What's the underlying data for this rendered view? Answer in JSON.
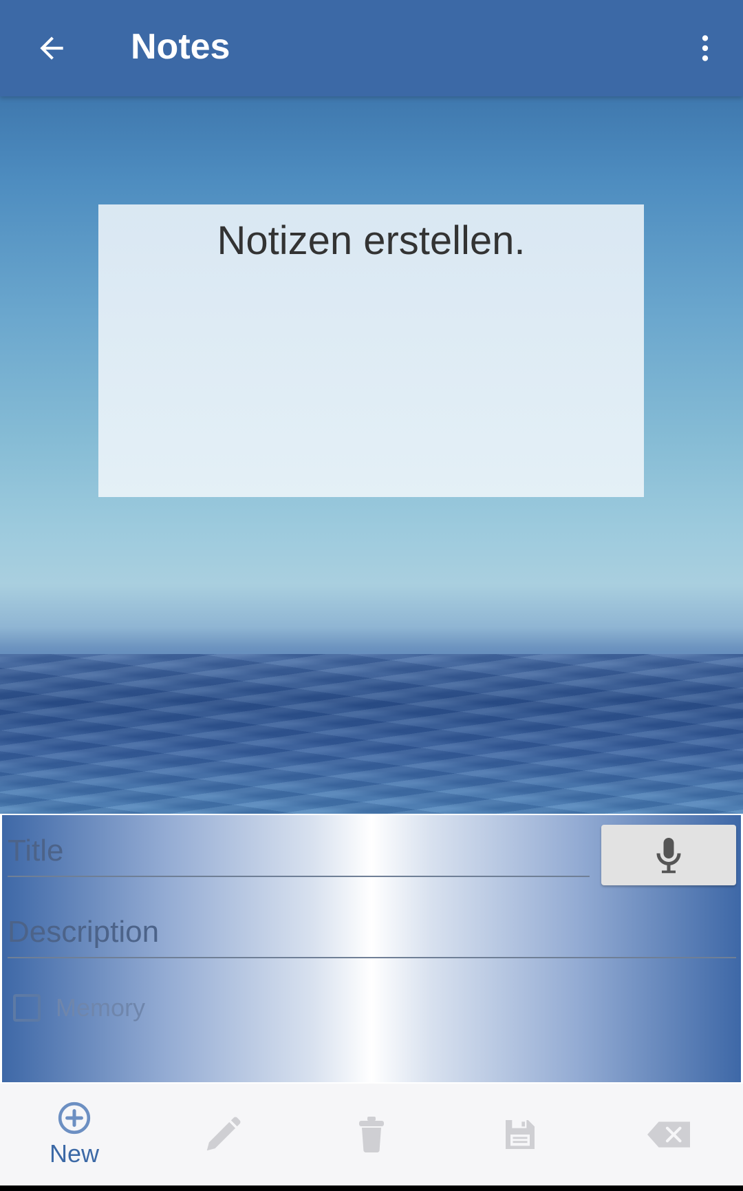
{
  "app_bar": {
    "title": "Notes",
    "back_icon": "arrow-back-icon",
    "overflow_icon": "more-vert-icon",
    "color": "#3c69a6"
  },
  "note_card": {
    "text": "Notizen erstellen."
  },
  "form": {
    "title_placeholder": "Title",
    "title_value": "",
    "mic_icon": "microphone-icon",
    "description_placeholder": "Description",
    "description_value": "",
    "memory_label": "Memory",
    "memory_checked": false
  },
  "bottom_bar": {
    "items": [
      {
        "name": "new",
        "label": "New",
        "icon": "add-circle-icon",
        "enabled": true
      },
      {
        "name": "edit",
        "label": "",
        "icon": "pencil-icon",
        "enabled": false
      },
      {
        "name": "delete",
        "label": "",
        "icon": "trash-icon",
        "enabled": false
      },
      {
        "name": "save",
        "label": "",
        "icon": "floppy-disk-icon",
        "enabled": false
      },
      {
        "name": "clear",
        "label": "",
        "icon": "backspace-icon",
        "enabled": false
      }
    ],
    "accent_color": "#3c69a6",
    "disabled_color": "#cfcfd3"
  }
}
